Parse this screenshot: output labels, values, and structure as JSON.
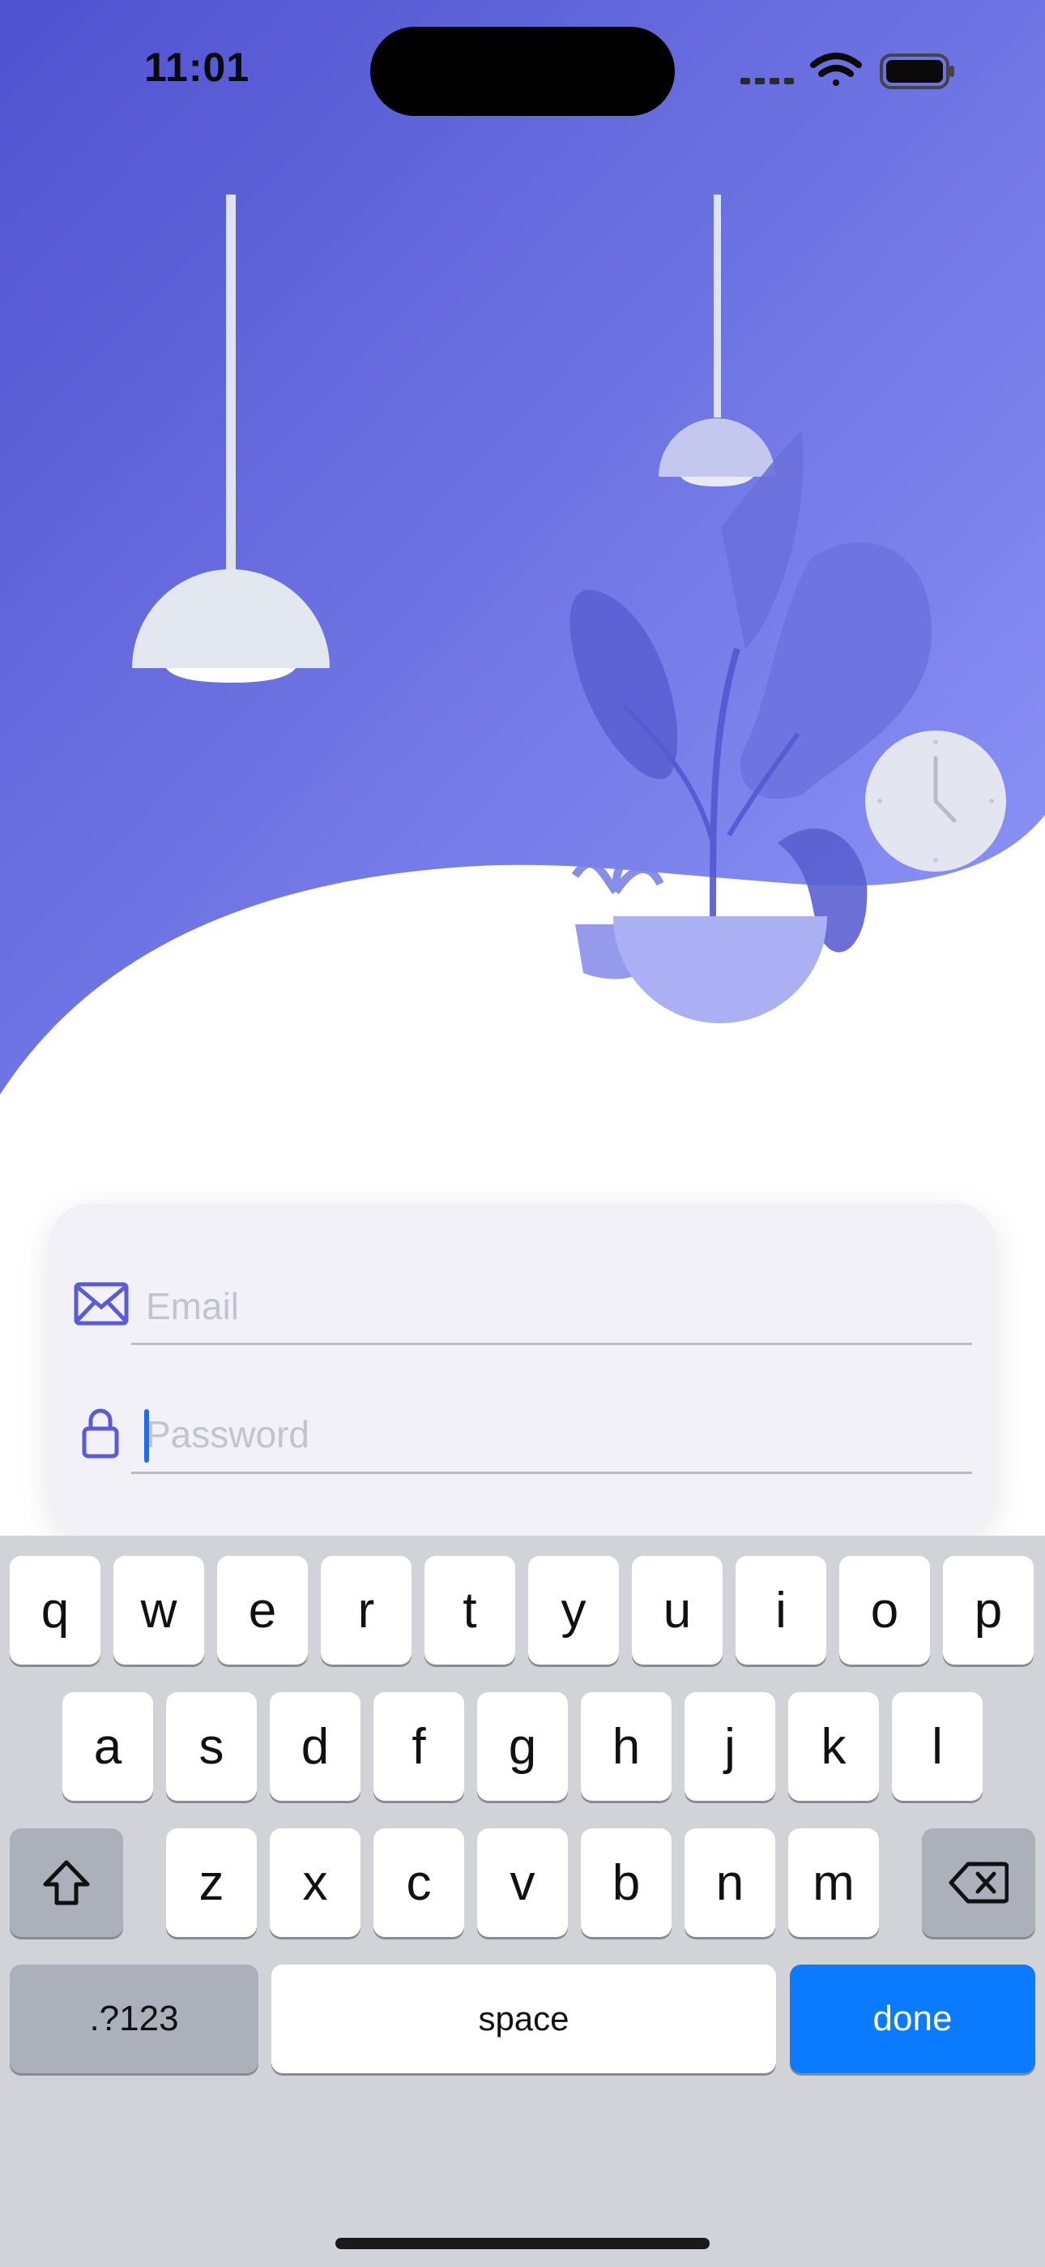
{
  "status_bar": {
    "time": "11:01"
  },
  "login": {
    "email_placeholder": "Email",
    "password_placeholder": "Password"
  },
  "keyboard": {
    "row1": [
      "q",
      "w",
      "e",
      "r",
      "t",
      "y",
      "u",
      "i",
      "o",
      "p"
    ],
    "row2": [
      "a",
      "s",
      "d",
      "f",
      "g",
      "h",
      "j",
      "k",
      "l"
    ],
    "row3": [
      "z",
      "x",
      "c",
      "v",
      "b",
      "n",
      "m"
    ],
    "numbers_label": ".?123",
    "space_label": "space",
    "done_label": "done"
  },
  "icons": {
    "email": "envelope-icon",
    "password": "lock-icon",
    "shift": "shift-icon",
    "delete": "delete-icon"
  },
  "colors": {
    "gradient_start": "#5156d2",
    "gradient_end": "#8a93f7",
    "accent_icon": "#5a5bd6",
    "done_key": "#0a7aff"
  }
}
